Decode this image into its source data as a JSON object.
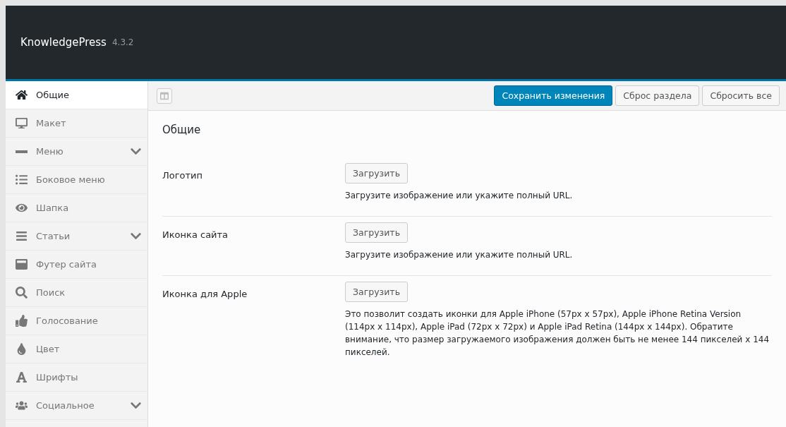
{
  "header": {
    "title": "KnowledgePress",
    "version": "4.3.2"
  },
  "sidebar": {
    "items": [
      {
        "label": "Общие",
        "selected": true,
        "expandable": false
      },
      {
        "label": "Макет",
        "selected": false,
        "expandable": false
      },
      {
        "label": "Меню",
        "selected": false,
        "expandable": true
      },
      {
        "label": "Боковое меню",
        "selected": false,
        "expandable": false
      },
      {
        "label": "Шапка",
        "selected": false,
        "expandable": false
      },
      {
        "label": "Статьи",
        "selected": false,
        "expandable": true
      },
      {
        "label": "Футер сайта",
        "selected": false,
        "expandable": false
      },
      {
        "label": "Поиск",
        "selected": false,
        "expandable": false
      },
      {
        "label": "Голосование",
        "selected": false,
        "expandable": false
      },
      {
        "label": "Цвет",
        "selected": false,
        "expandable": false
      },
      {
        "label": "Шрифты",
        "selected": false,
        "expandable": false
      },
      {
        "label": "Социальное",
        "selected": false,
        "expandable": true
      }
    ]
  },
  "toolbar": {
    "buttons": [
      {
        "label": "Сохранить изменения",
        "kind": "primary"
      },
      {
        "label": "Сброс раздела",
        "kind": "secondary"
      },
      {
        "label": "Сбросить все",
        "kind": "secondary"
      }
    ]
  },
  "section": {
    "title": "Общие",
    "fields": [
      {
        "label": "Логотип",
        "button": "Загрузить",
        "description": "Загрузите изображение или укажите полный URL."
      },
      {
        "label": "Иконка сайта",
        "button": "Загрузить",
        "description": "Загрузите изображение или укажите полный URL."
      },
      {
        "label": "Иконка для Apple",
        "button": "Загрузить",
        "description": "Это позволит создать иконки для Apple iPhone (57px x 57px), Apple iPhone Retina Version (114px x 114px), Apple iPad (72px x 72px) и Apple iPad Retina (144px x 144px). Обратите внимание, что размер загружаемого изображения должен быть не менее 144 пикселей x 144 пикселей."
      }
    ]
  }
}
